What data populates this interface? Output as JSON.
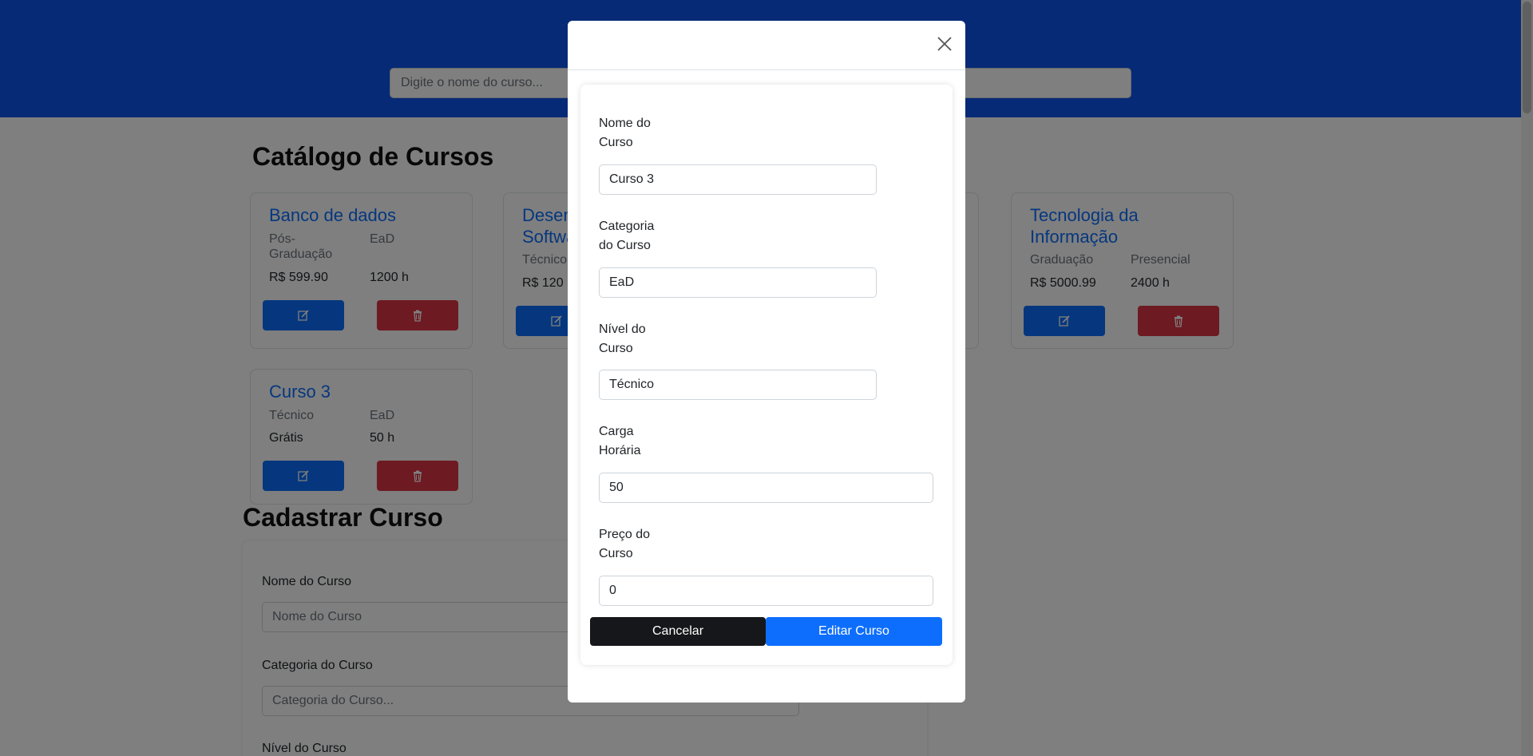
{
  "header": {
    "search_placeholder": "Digite o nome do curso..."
  },
  "catalog": {
    "title": "Catálogo de Cursos",
    "courses": [
      {
        "name": "Banco de dados",
        "level": "Pós-Graduação",
        "category": "EaD",
        "price": "R$ 599.90",
        "hours": "1200 h"
      },
      {
        "name": "Desenvolvimento de Software",
        "level": "Técnico",
        "price": "R$ 120"
      },
      {
        "name": "Tecnologia da Informação",
        "level": "Graduação",
        "category": "Presencial",
        "price": "R$ 5000.99",
        "hours": "2400 h"
      },
      {
        "name": "Curso 3",
        "level": "Técnico",
        "category": "EaD",
        "price": "Grátis",
        "hours": "50 h"
      }
    ],
    "edit_icon": "edit-icon",
    "delete_icon": "trash-icon"
  },
  "register": {
    "title": "Cadastrar Curso",
    "fields": [
      {
        "label": "Nome do Curso",
        "placeholder": "Nome do Curso"
      },
      {
        "label": "Categoria do Curso",
        "placeholder": "Categoria do Curso..."
      },
      {
        "label": "Nível do Curso"
      }
    ]
  },
  "modal": {
    "close_icon": "close-icon",
    "fields": [
      {
        "label": "Nome do Curso",
        "value": "Curso 3"
      },
      {
        "label": "Categoria do Curso",
        "value": "EaD"
      },
      {
        "label": "Nível do Curso",
        "value": "Técnico"
      },
      {
        "label": "Carga Horária",
        "value": "50"
      },
      {
        "label": "Preço do Curso",
        "value": "0"
      }
    ],
    "cancel_label": "Cancelar",
    "submit_label": "Editar Curso"
  },
  "colors": {
    "header_bg": "#0d55ec",
    "primary": "#0d6efd",
    "danger": "#dc3545",
    "dark_button": "#15171a"
  }
}
